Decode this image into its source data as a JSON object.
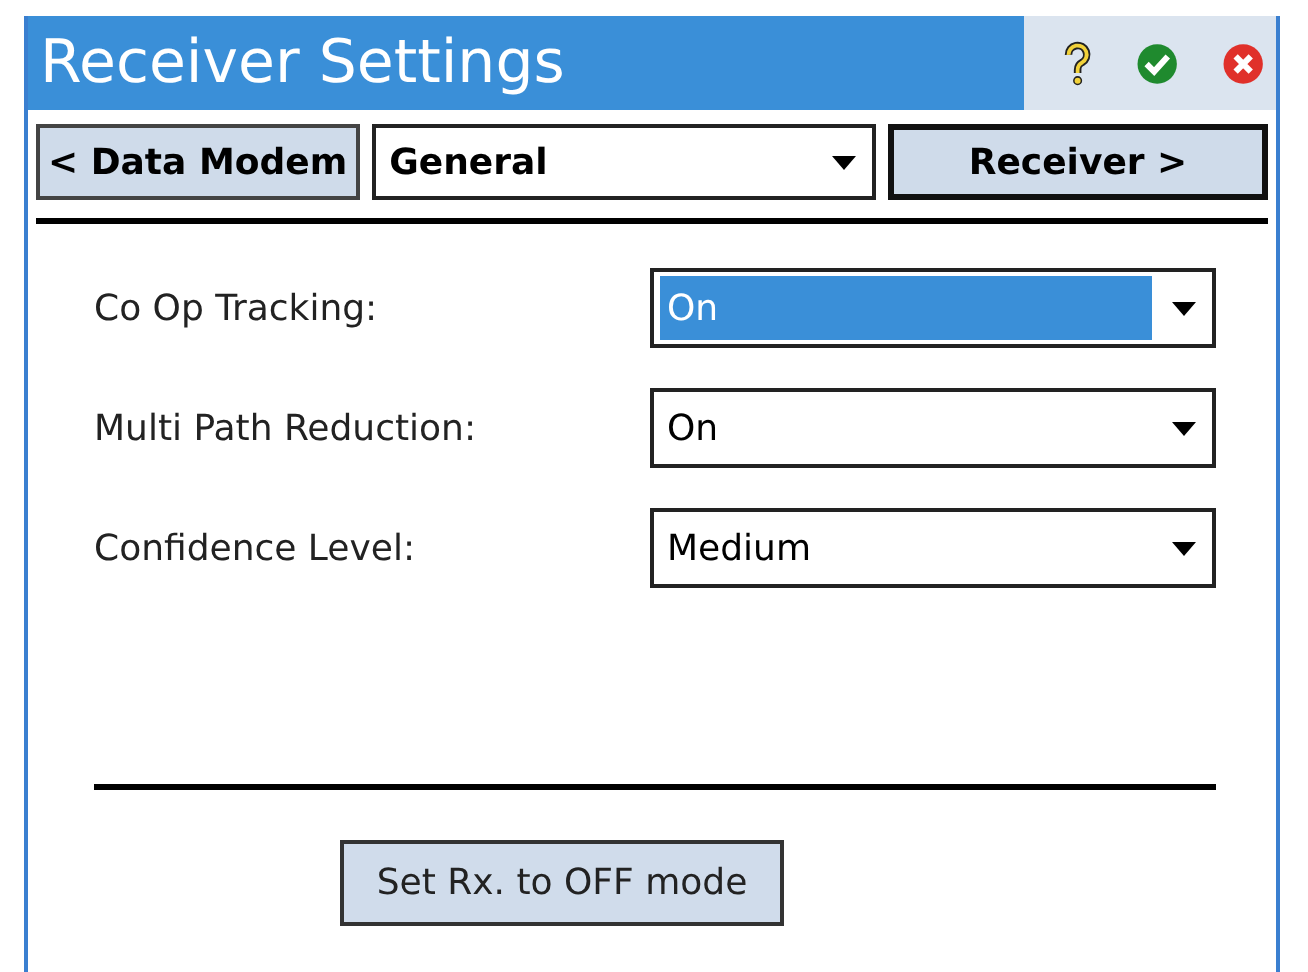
{
  "window": {
    "title": "Receiver Settings"
  },
  "nav": {
    "previous": "< Data Modem",
    "page": "General",
    "next": "Receiver >"
  },
  "fields": [
    {
      "label": "Co Op Tracking:",
      "value": "On",
      "selected": true
    },
    {
      "label": "Multi Path Reduction:",
      "value": "On",
      "selected": false
    },
    {
      "label": "Confidence Level:",
      "value": "Medium",
      "selected": false
    }
  ],
  "action_button": "Set Rx. to OFF mode"
}
